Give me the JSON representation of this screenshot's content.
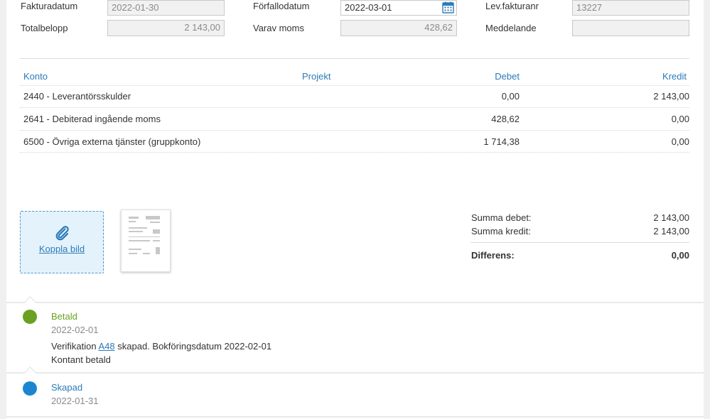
{
  "form": {
    "fakturadatum_label": "Fakturadatum",
    "fakturadatum_value": "2022-01-30",
    "forfallodatum_label": "Förfallodatum",
    "forfallodatum_value": "2022-03-01",
    "levfakturanr_label": "Lev.fakturanr",
    "levfakturanr_value": "13227",
    "totalbelopp_label": "Totalbelopp",
    "totalbelopp_value": "2 143,00",
    "varav_moms_label": "Varav moms",
    "varav_moms_value": "428,62",
    "meddelande_label": "Meddelande",
    "meddelande_value": ""
  },
  "table": {
    "headers": {
      "konto": "Konto",
      "projekt": "Projekt",
      "debet": "Debet",
      "kredit": "Kredit"
    },
    "rows": [
      {
        "konto": "2440  -  Leverantörsskulder",
        "projekt": "",
        "debet": "0,00",
        "kredit": "2 143,00"
      },
      {
        "konto": "2641  -  Debiterad ingående moms",
        "projekt": "",
        "debet": "428,62",
        "kredit": "0,00"
      },
      {
        "konto": "6500  -  Övriga externa tjänster (gruppkonto)",
        "projekt": "",
        "debet": "1 714,38",
        "kredit": "0,00"
      }
    ]
  },
  "attachment": {
    "link_label": "Koppla bild",
    "icon": "paperclip-icon"
  },
  "summary": {
    "summa_debet_label": "Summa debet:",
    "summa_debet_value": "2 143,00",
    "summa_kredit_label": "Summa kredit:",
    "summa_kredit_value": "2 143,00",
    "differens_label": "Differens:",
    "differens_value": "0,00"
  },
  "timeline": [
    {
      "title": "Betald",
      "date": "2022-02-01",
      "color": "#6aa121",
      "text_prefix": "Verifikation ",
      "link": "A48",
      "text_suffix": " skapad. Bokföringsdatum 2022-02-01",
      "text2": "Kontant betald"
    },
    {
      "title": "Skapad",
      "date": "2022-01-31",
      "color": "#1a86d0"
    }
  ],
  "colors": {
    "accent": "#2b7bb9",
    "paid": "#6aa121",
    "created": "#1a86d0"
  }
}
